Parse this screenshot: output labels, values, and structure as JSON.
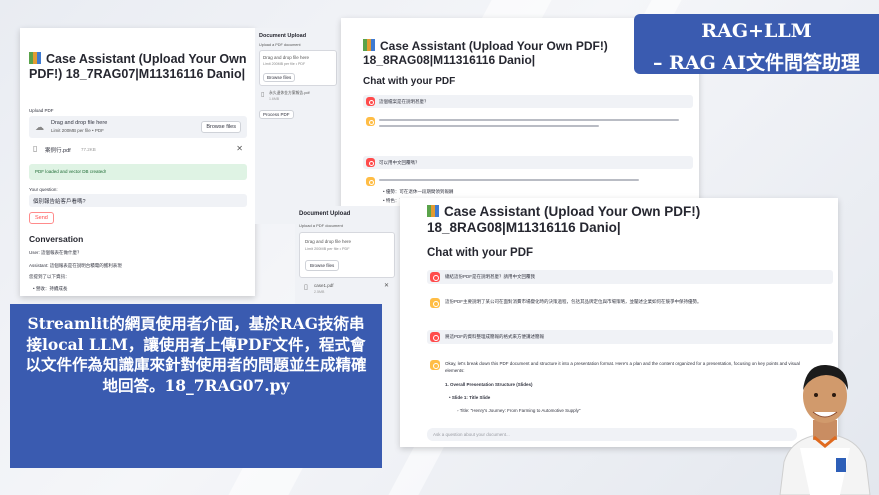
{
  "badge": {
    "line1": "RAG+LLM",
    "line2": "– RAG AI文件問答助理"
  },
  "description": "Streamlit的網頁使用者介面，基於RAG技術串接local LLM，讓使用者上傳PDF文件，程式會以文件作為知識庫來針對使用者的問題並生成精確地回答。18_7RAG07.py",
  "shot1": {
    "title": "Case Assistant (Upload Your Own PDF!) 18_7RAG07|M11316116 Danio|",
    "upload_label": "Upload PDF",
    "dropzone_title": "Drag and drop file here",
    "dropzone_limit": "Limit 200MB per file • PDF",
    "browse_label": "Browse files",
    "file_name": "案例行.pdf",
    "file_size": "77.2KB",
    "success_text": "PDF loaded and vector DB created!",
    "question_label": "Your question:",
    "question_value": "個別報告給客戶看嗎?",
    "send_label": "Send",
    "conversation_heading": "Conversation",
    "user_line": "User: 這個報表在做什麼？",
    "assistant_line": "Assistant: 這個報表是在說明台積電的獲利表現",
    "followup_line": "您提到了以下資訊：",
    "bullet_text": "營收：持續成長"
  },
  "shot2": {
    "title": "Case Assistant (Upload Your Own PDF!) 18_8RAG08|M11316116 Danio|",
    "chat_heading": "Chat with your PDF",
    "sidebar_heading": "Document Upload",
    "sidebar_label": "Upload a PDF document",
    "dropzone_title": "Drag and drop file here",
    "dropzone_limit": "Limit 200MB per file • PDF",
    "browse_label": "Browse files",
    "file_name": "永久退休金方案報告.pdf",
    "file_size": "1.6MB",
    "process_label": "Process PDF",
    "q1": "這個檔案是在說明甚麼？",
    "q2": "可以用中文回覆嗎？",
    "bullets": [
      "優勢：可在退休一段期間領到報酬",
      "特色：可在退休一段期間領到報酬",
      "優勢：可在退休一段期間領到報酬"
    ]
  },
  "shot3": {
    "title": "Case Assistant (Upload Your Own PDF!) 18_8RAG08|M11316116 Danio|",
    "chat_heading": "Chat with your PDF",
    "sidebar_heading": "Document Upload",
    "sidebar_label": "Upload a PDF document",
    "dropzone_title": "Drag and drop file here",
    "dropzone_limit": "Limit 200MB per file • PDF",
    "browse_label": "Browse files",
    "file_name": "case1.pdf",
    "file_size": "2.5MB",
    "process_label": "Process PDF",
    "q1": "總結這份PDF是在說明甚麼？請用中文回覆我",
    "a1": "這份PDF主要說明了某公司在面對消費市場變化時的決策過程，包括其品牌定位與市場策略，並闡述企業如何在競爭中保持優勢。",
    "q2": "將這PDF的資料整理成簡報的格式來方便講述簡報",
    "a2": "Okay, let's break down this PDF document and structure it into a presentation format. Here's a plan and the content organized for a presentation, focusing on key points and visual elements:",
    "a2_h1": "1. Overall Presentation Structure (Slides)",
    "a2_h2": "Slide 1: Title Slide",
    "a2_h3": "Title: \"Henry's Journey: From Farming to Automotive Supply\"",
    "input_placeholder": "Ask a question about your document..."
  }
}
